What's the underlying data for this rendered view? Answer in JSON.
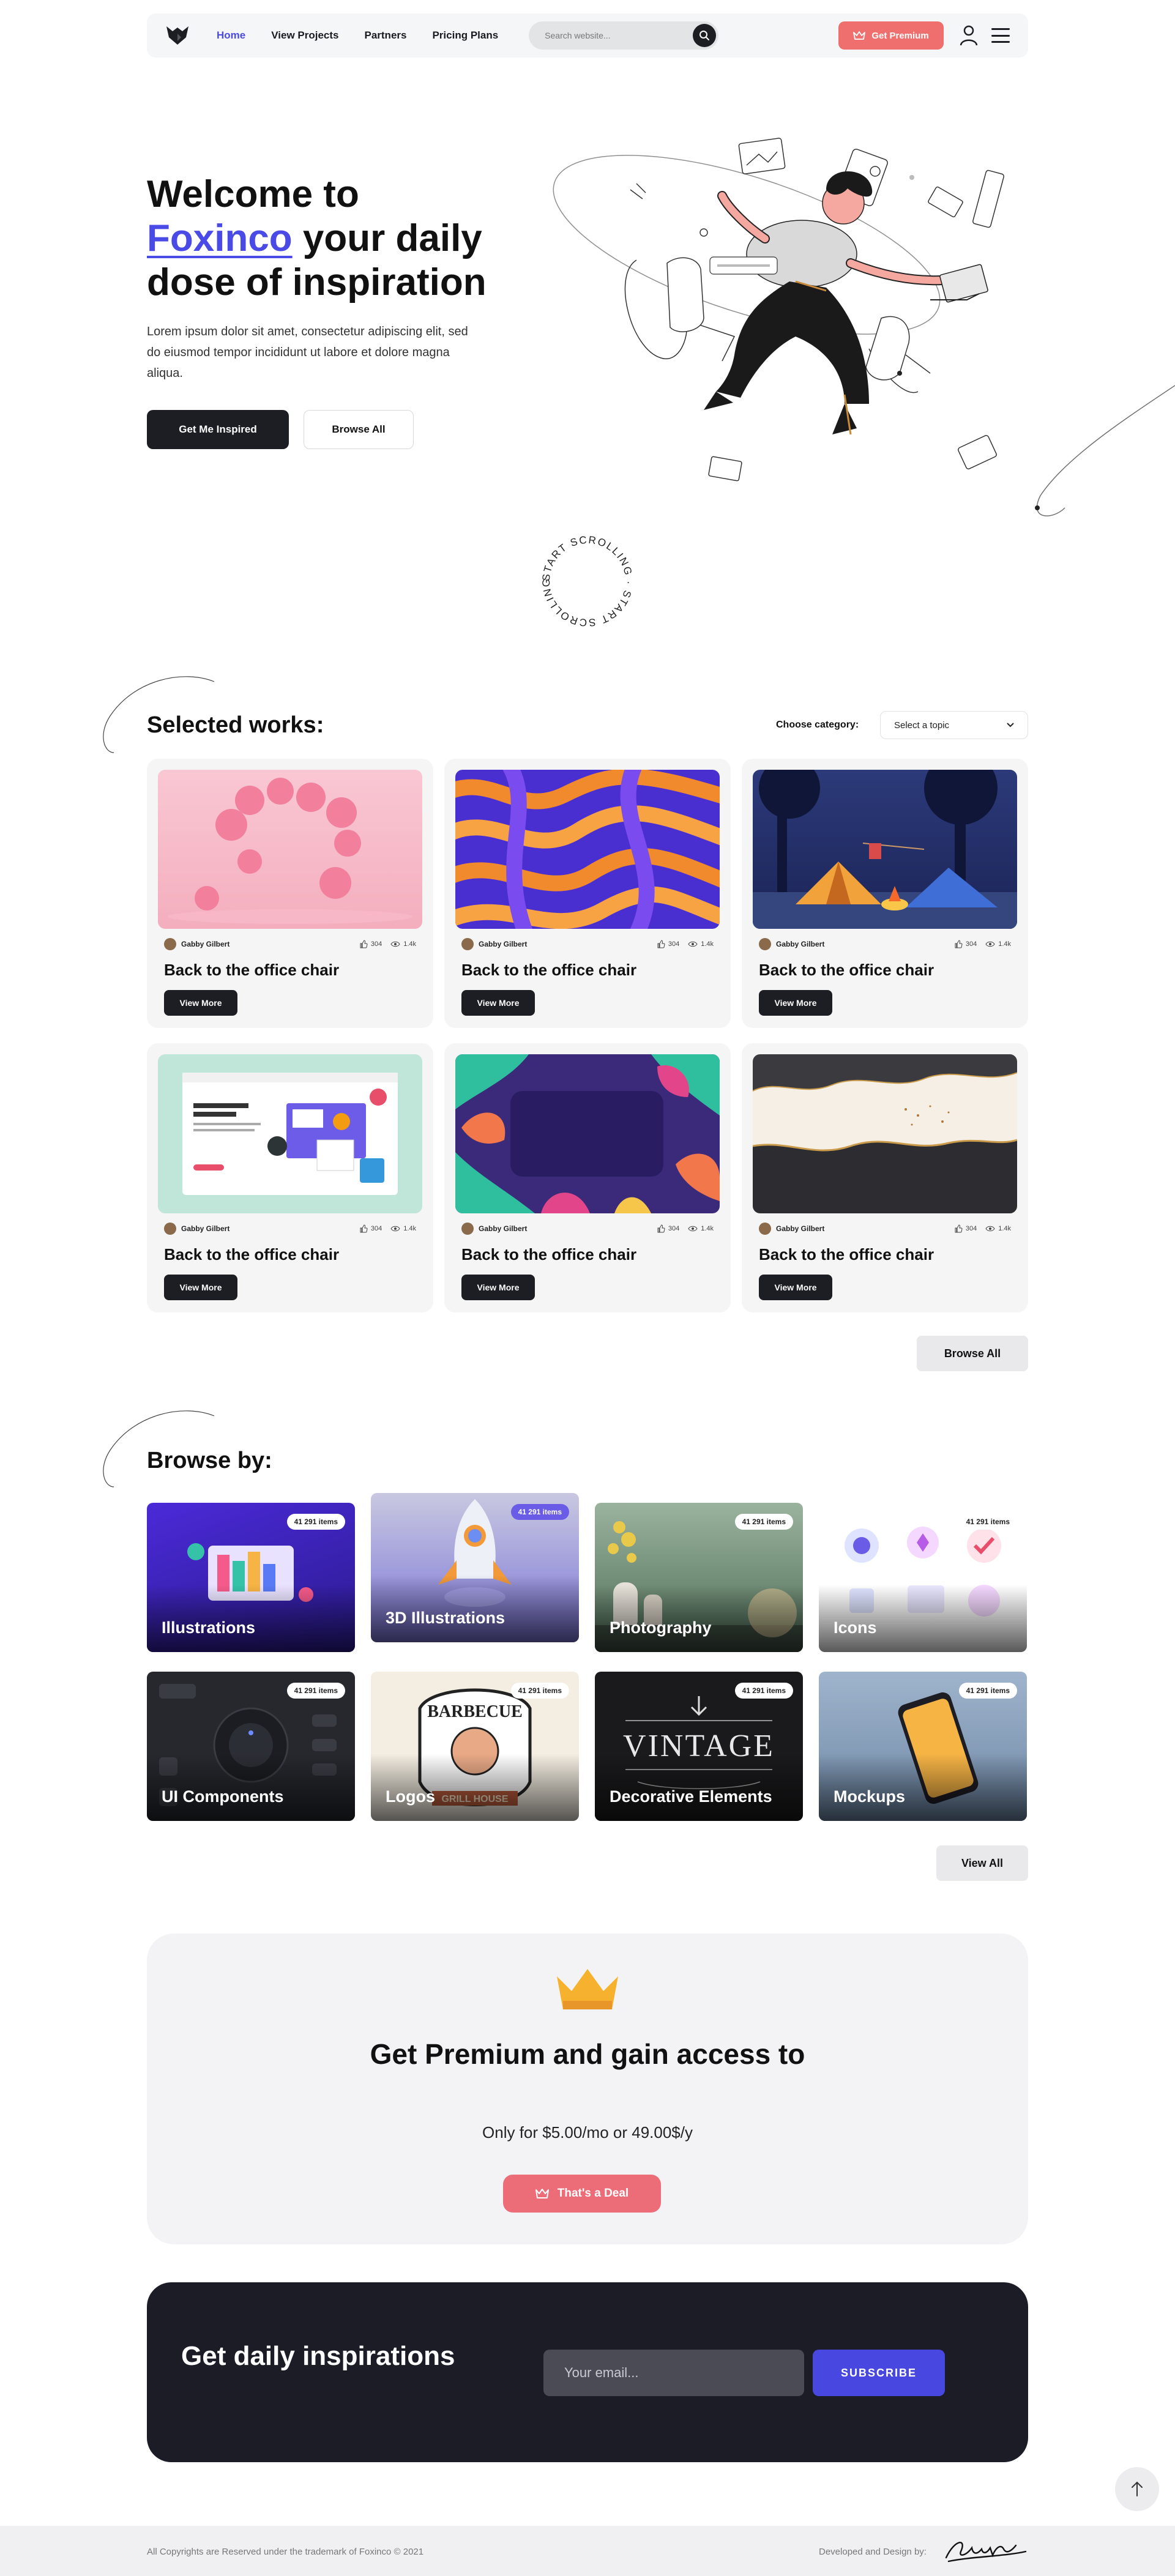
{
  "nav": {
    "links": [
      "Home",
      "View Projects",
      "Partners",
      "Pricing Plans"
    ],
    "search_placeholder": "Search website...",
    "premium_label": "Get Premium"
  },
  "hero": {
    "title_line1": "Welcome to",
    "brand": "Foxinco",
    "title_rest1": " your daily",
    "title_line3": "dose of inspiration",
    "description": "Lorem ipsum dolor sit amet, consectetur adipiscing elit, sed do eiusmod tempor incididunt ut labore et dolore magna aliqua.",
    "primary_button": "Get Me Inspired",
    "secondary_button": "Browse All",
    "scroll_text": "START SCROLLING · START SCROLLING · "
  },
  "works": {
    "title": "Selected works:",
    "category_label": "Choose category:",
    "category_value": "Select a topic",
    "cards": [
      {
        "author": "Gabby Gilbert",
        "likes": "304",
        "views": "1.4k",
        "title": "Back to the office chair",
        "button": "View More"
      },
      {
        "author": "Gabby Gilbert",
        "likes": "304",
        "views": "1.4k",
        "title": "Back to the office chair",
        "button": "View More"
      },
      {
        "author": "Gabby Gilbert",
        "likes": "304",
        "views": "1.4k",
        "title": "Back to the office chair",
        "button": "View More"
      },
      {
        "author": "Gabby Gilbert",
        "likes": "304",
        "views": "1.4k",
        "title": "Back to the office chair",
        "button": "View More"
      },
      {
        "author": "Gabby Gilbert",
        "likes": "304",
        "views": "1.4k",
        "title": "Back to the office chair",
        "button": "View More"
      },
      {
        "author": "Gabby Gilbert",
        "likes": "304",
        "views": "1.4k",
        "title": "Back to the office chair",
        "button": "View More"
      }
    ],
    "browse_all": "Browse All"
  },
  "browse": {
    "title": "Browse by:",
    "tiles": [
      {
        "name": "Illustrations",
        "count": "41 291 items"
      },
      {
        "name": "3D Illustrations",
        "count": "41 291 items"
      },
      {
        "name": "Photography",
        "count": "41 291 items"
      },
      {
        "name": "Icons",
        "count": "41 291 items"
      },
      {
        "name": "UI Components",
        "count": "41 291 items"
      },
      {
        "name": "Logos",
        "count": "41 291 items"
      },
      {
        "name": "Decorative Elements",
        "count": "41 291 items"
      },
      {
        "name": "Mockups",
        "count": "41 291 items"
      }
    ],
    "view_all": "View All"
  },
  "premium": {
    "title": "Get Premium and gain access to",
    "price": "Only for $5.00/mo or 49.00$/y",
    "button": "That's a Deal"
  },
  "newsletter": {
    "title": "Get daily inspirations",
    "placeholder": "Your email...",
    "button": "SUBSCRIBE"
  },
  "footer": {
    "copyright": "All Copyrights are Reserved under the trademark of Foxinco © 2021",
    "developed": "Developed and Design by:"
  },
  "colors": {
    "accent": "#4a4ae6",
    "premium": "#ef6f6f",
    "dark": "#1d1d24"
  }
}
